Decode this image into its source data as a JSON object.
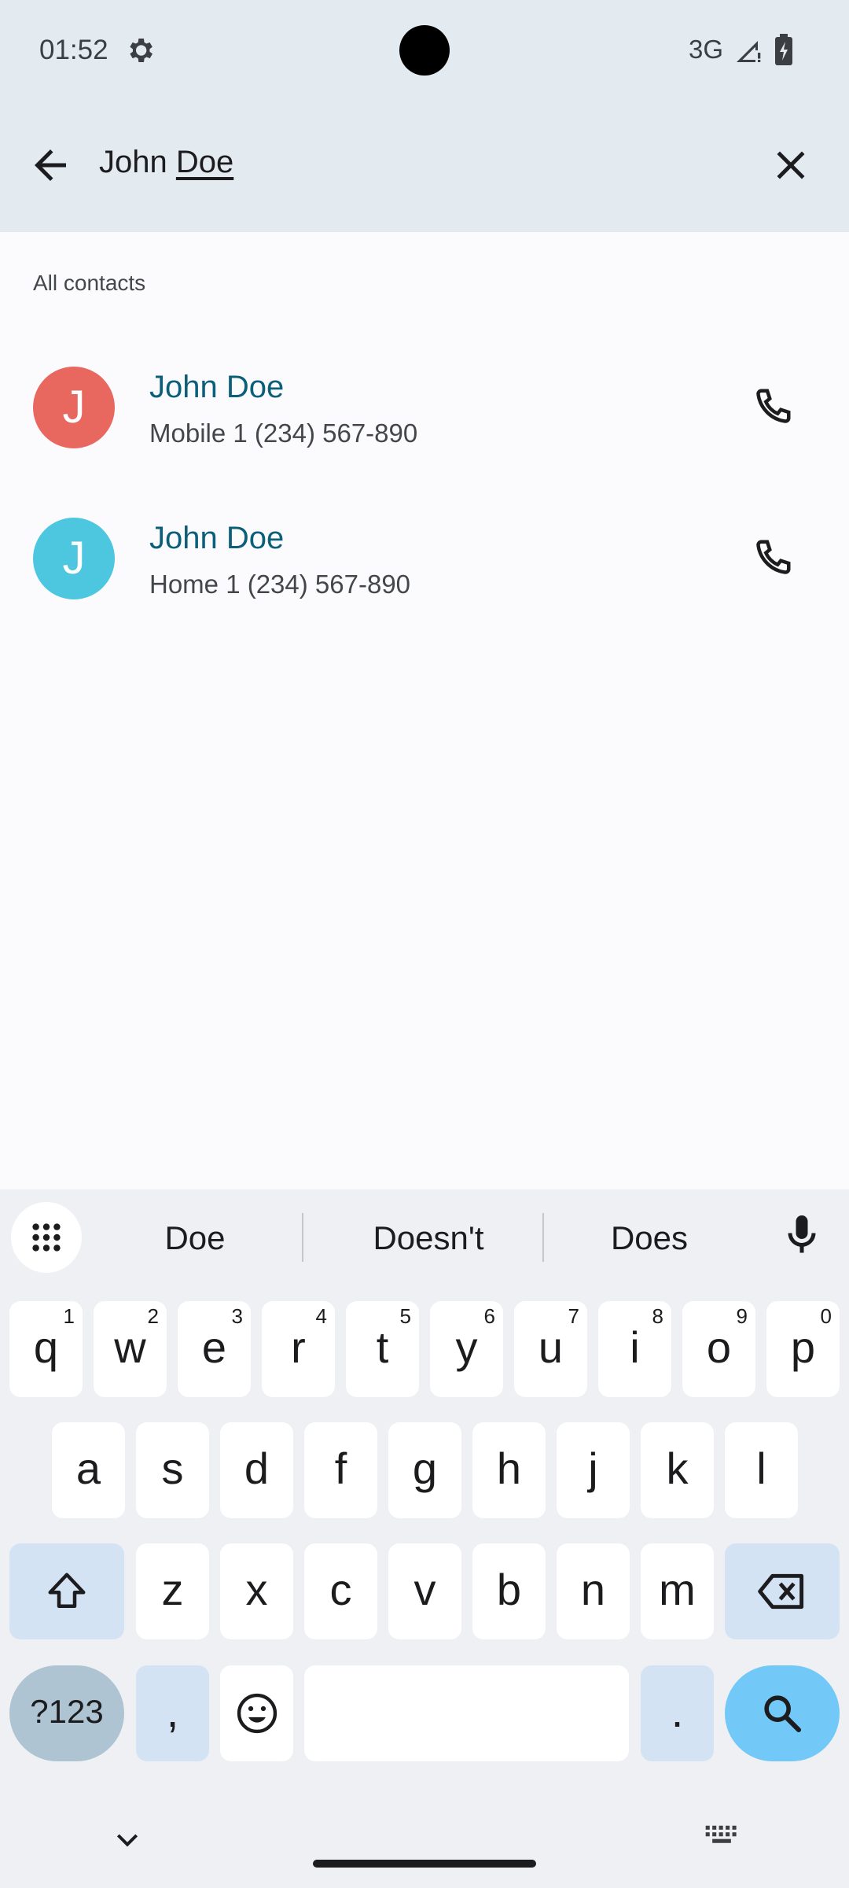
{
  "status_bar": {
    "time": "01:52",
    "network": "3G"
  },
  "search": {
    "query_prefix": "John ",
    "query_underlined": "Doe"
  },
  "section_header": "All contacts",
  "contacts": [
    {
      "initial": "J",
      "name": "John Doe",
      "detail": "Mobile 1 (234) 567-890",
      "avatar_color": "#e8685f"
    },
    {
      "initial": "J",
      "name": "John Doe",
      "detail": "Home 1 (234) 567-890",
      "avatar_color": "#4dc7e0"
    }
  ],
  "keyboard": {
    "suggestions": [
      "Doe",
      "Doesn't",
      "Does"
    ],
    "row1": [
      {
        "key": "q",
        "hint": "1"
      },
      {
        "key": "w",
        "hint": "2"
      },
      {
        "key": "e",
        "hint": "3"
      },
      {
        "key": "r",
        "hint": "4"
      },
      {
        "key": "t",
        "hint": "5"
      },
      {
        "key": "y",
        "hint": "6"
      },
      {
        "key": "u",
        "hint": "7"
      },
      {
        "key": "i",
        "hint": "8"
      },
      {
        "key": "o",
        "hint": "9"
      },
      {
        "key": "p",
        "hint": "0"
      }
    ],
    "row2": [
      "a",
      "s",
      "d",
      "f",
      "g",
      "h",
      "j",
      "k",
      "l"
    ],
    "row3": [
      "z",
      "x",
      "c",
      "v",
      "b",
      "n",
      "m"
    ],
    "symbols_label": "?123",
    "comma": ",",
    "period": "."
  },
  "colors": {
    "header_bg": "#e3ebf1",
    "contact_name": "#0b5f7a",
    "keyboard_bg": "#eef0f4",
    "enter_key": "#72c8f7"
  }
}
